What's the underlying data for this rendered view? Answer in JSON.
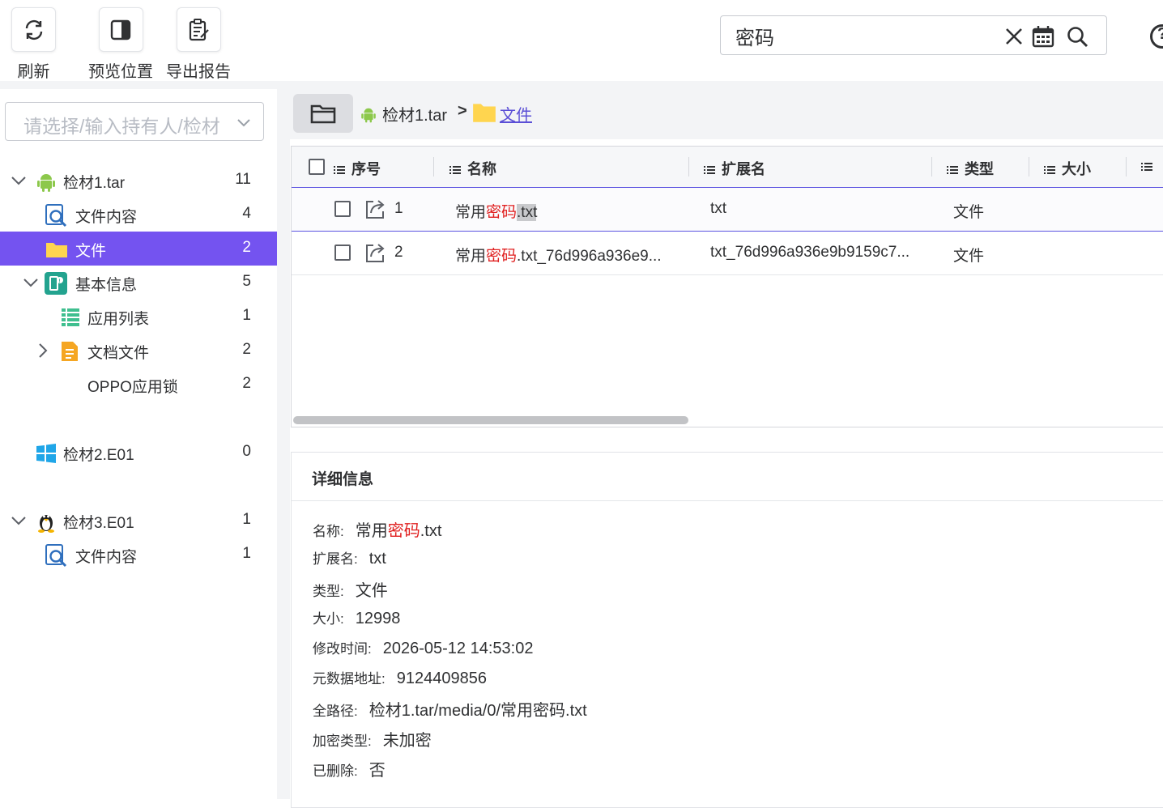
{
  "toolbar": {
    "refresh_label": "刷新",
    "preview_label": "预览位置",
    "export_label": "导出报告"
  },
  "search": {
    "value": "密码",
    "icons": [
      "clear-icon",
      "calendar-icon",
      "search-icon"
    ]
  },
  "sidebar": {
    "owner_placeholder": "请选择/输入持有人/检材",
    "tree": [
      {
        "label": "检材1.tar",
        "count": "11",
        "icon": "android-icon"
      },
      {
        "label": "文件内容",
        "count": "4",
        "icon": "file-search-icon"
      },
      {
        "label": "文件",
        "count": "2",
        "icon": "folder-icon"
      },
      {
        "label": "基本信息",
        "count": "5",
        "icon": "basic-info-icon"
      },
      {
        "label": "应用列表",
        "count": "1",
        "icon": "app-list-icon"
      },
      {
        "label": "文档文件",
        "count": "2",
        "icon": "document-icon"
      },
      {
        "label": "OPPO应用锁",
        "count": "2"
      },
      {
        "label": "检材2.E01",
        "count": "0",
        "icon": "windows-icon"
      },
      {
        "label": "检材3.E01",
        "count": "1",
        "icon": "linux-icon"
      },
      {
        "label": "文件内容",
        "count": "1",
        "icon": "file-search-icon"
      }
    ]
  },
  "breadcrumb": {
    "root": "检材1.tar",
    "separator": ">",
    "current": "文件"
  },
  "table": {
    "columns": [
      "序号",
      "名称",
      "扩展名",
      "类型",
      "大小"
    ],
    "rows": [
      {
        "index": "1",
        "name_prefix": "常用",
        "name_highlight": "密码",
        "name_suffix": ".txt",
        "ext": "txt",
        "type": "文件"
      },
      {
        "index": "2",
        "name_prefix": "常用",
        "name_highlight": "密码",
        "name_suffix": ".txt_76d996a936e9...",
        "ext": "txt_76d996a936e9b9159c7...",
        "type": "文件"
      }
    ]
  },
  "detail": {
    "title": "详细信息",
    "name_label": "名称:",
    "name_prefix": "常用",
    "name_highlight": "密码",
    "name_suffix": ".txt",
    "fields": [
      {
        "key": "扩展名:",
        "value": "txt"
      },
      {
        "key": "类型:",
        "value": "文件"
      },
      {
        "key": "大小:",
        "value": "12998"
      },
      {
        "key": "修改时间:",
        "value": "2026-05-12 14:53:02"
      },
      {
        "key": "元数据地址:",
        "value": "9124409856"
      },
      {
        "key": "全路径:",
        "value": "检材1.tar/media/0/常用密码.txt"
      },
      {
        "key": "加密类型:",
        "value": "未加密"
      },
      {
        "key": "已删除:",
        "value": "否"
      }
    ]
  },
  "colors": {
    "accent": "#7453f0",
    "highlight": "#e02020",
    "link": "#5b4fd6"
  }
}
